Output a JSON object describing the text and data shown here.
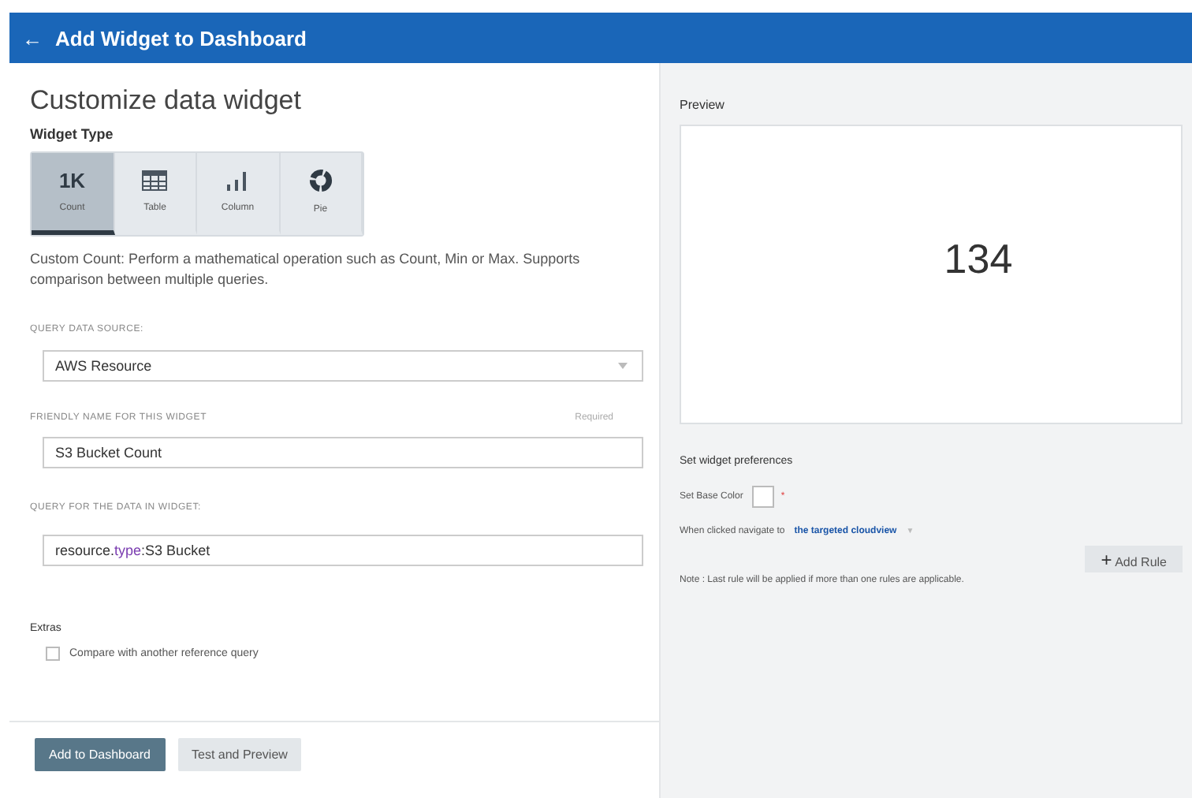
{
  "header": {
    "back_icon": "←",
    "title": "Add Widget to Dashboard"
  },
  "form": {
    "title": "Customize data widget",
    "widget_type_label": "Widget Type",
    "widget_types": [
      {
        "kind": "count",
        "glyph": "1K",
        "label": "Count",
        "selected": true
      },
      {
        "kind": "table",
        "label": "Table",
        "selected": false
      },
      {
        "kind": "column",
        "label": "Column",
        "selected": false
      },
      {
        "kind": "pie",
        "label": "Pie",
        "selected": false
      }
    ],
    "description": "Custom Count: Perform a mathematical operation such as Count, Min or Max. Supports comparison between multiple queries.",
    "source_label": "QUERY DATA SOURCE:",
    "source_value": "AWS Resource",
    "name_label": "FRIENDLY NAME FOR THIS WIDGET",
    "name_required": "Required",
    "name_value": "S3 Bucket Count",
    "query_label": "QUERY FOR THE DATA IN WIDGET:",
    "query_parts": [
      {
        "kind": "plain",
        "text": "resource."
      },
      {
        "kind": "keyword",
        "text": "type"
      },
      {
        "kind": "plain",
        "text": ":S3 Bucket"
      }
    ],
    "extras_label": "Extras",
    "compare": {
      "label": "Compare with another reference query",
      "checked": false
    },
    "buttons": [
      {
        "kind": "primary",
        "label": "Add to Dashboard"
      },
      {
        "kind": "secondary",
        "label": "Test and Preview"
      }
    ]
  },
  "preview": {
    "label": "Preview",
    "value": "134"
  },
  "preferences": {
    "title": "Set widget preferences",
    "base_color_label": "Set Base Color",
    "required_mark": "*",
    "navigate_label": "When clicked navigate to",
    "navigate_value": "the targeted cloudview",
    "navigate_caret": "▼",
    "add_rule_icon": "+",
    "add_rule": "Add Rule",
    "note": "Note : Last rule will be applied if more than one rules are applicable."
  }
}
